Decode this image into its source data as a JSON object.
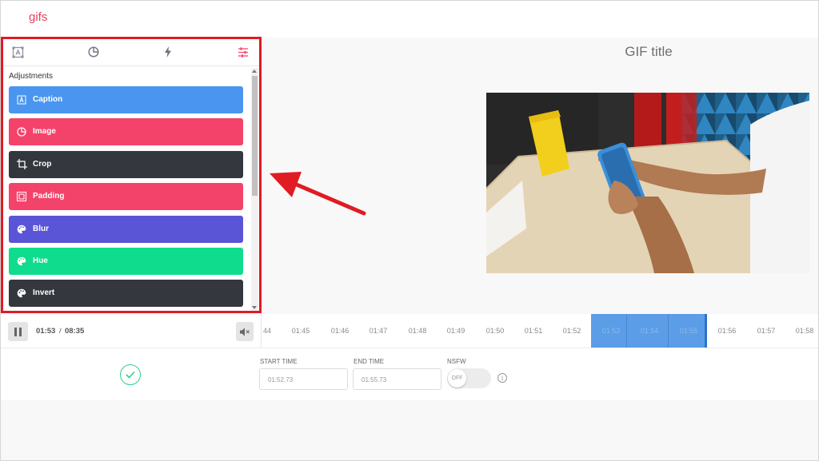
{
  "header": {
    "brand": "gifs"
  },
  "panel": {
    "tabs": [
      {
        "name": "caption-tab",
        "icon": "caption-icon"
      },
      {
        "name": "image-tab",
        "icon": "image-icon"
      },
      {
        "name": "effects-tab",
        "icon": "bolt-icon"
      },
      {
        "name": "adjustments-tab",
        "icon": "sliders-icon"
      }
    ],
    "title": "Adjustments",
    "items": [
      {
        "label": "Caption",
        "color": "#4a95f0",
        "icon": "caption-icon"
      },
      {
        "label": "Image",
        "color": "#f4436b",
        "icon": "image-icon"
      },
      {
        "label": "Crop",
        "color": "#34373d",
        "icon": "crop-icon"
      },
      {
        "label": "Padding",
        "color": "#f4436b",
        "icon": "padding-icon"
      },
      {
        "label": "Blur",
        "color": "#5a55d6",
        "icon": "palette-icon"
      },
      {
        "label": "Hue",
        "color": "#10dc8d",
        "icon": "palette-icon"
      },
      {
        "label": "Invert",
        "color": "#34373d",
        "icon": "palette-icon"
      }
    ]
  },
  "preview": {
    "title": "GIF title"
  },
  "controls": {
    "current": "01:53",
    "separator": "/",
    "total": "08:35"
  },
  "timeline": {
    "ticks": [
      "44",
      "01:45",
      "01:46",
      "01:47",
      "01:48",
      "01:49",
      "01:50",
      "01:51",
      "01:52",
      "01:53",
      "01:54",
      "01:55",
      "01:56",
      "01:57",
      "01:58"
    ],
    "selection_color": "#5b9de6"
  },
  "form": {
    "start_label": "START TIME",
    "start_value": "01:52.73",
    "end_label": "END TIME",
    "end_value": "01:55.73",
    "nsfw_label": "NSFW",
    "nsfw_state": "OFF",
    "info_glyph": "i"
  },
  "colors": {
    "accent": "#e8405f",
    "highlight": "#e01b24",
    "confirm": "#2ecf8a"
  }
}
